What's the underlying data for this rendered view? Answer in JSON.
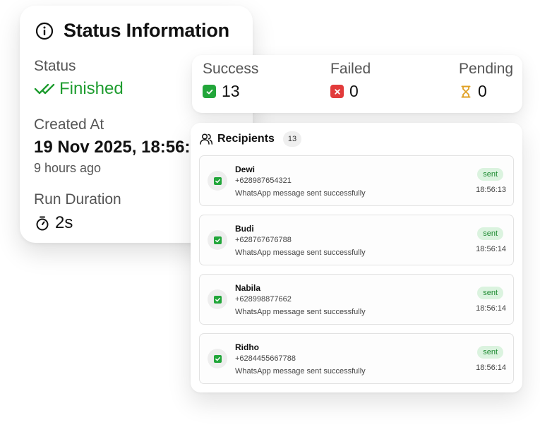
{
  "status_card": {
    "title": "Status Information",
    "status_label": "Status",
    "status_value": "Finished",
    "created_label": "Created At",
    "created_value": "19 Nov 2025, 18:56:13",
    "created_relative": "9 hours ago",
    "duration_label": "Run Duration",
    "duration_value": "2s"
  },
  "stats": {
    "success": {
      "label": "Success",
      "value": "13",
      "icon": "check-square-icon",
      "color": "#22a63a"
    },
    "failed": {
      "label": "Failed",
      "value": "0",
      "icon": "x-square-icon",
      "color": "#e23b3b"
    },
    "pending": {
      "label": "Pending",
      "value": "0",
      "icon": "hourglass-icon",
      "color": "#e0a125"
    }
  },
  "recipients": {
    "title": "Recipients",
    "count": "13",
    "items": [
      {
        "name": "Dewi",
        "phone": "+628987654321",
        "message": "WhatsApp message sent successfully",
        "status": "sent",
        "time": "18:56:13"
      },
      {
        "name": "Budi",
        "phone": "+628767676788",
        "message": "WhatsApp message sent successfully",
        "status": "sent",
        "time": "18:56:14"
      },
      {
        "name": "Nabila",
        "phone": "+628998877662",
        "message": "WhatsApp message sent successfully",
        "status": "sent",
        "time": "18:56:14"
      },
      {
        "name": "Ridho",
        "phone": "+6284455667788",
        "message": "WhatsApp message sent successfully",
        "status": "sent",
        "time": "18:56:14"
      }
    ]
  },
  "colors": {
    "accent_green": "#1e9c2f",
    "sent_badge_bg": "#dbf3df",
    "failed_red": "#e23b3b",
    "pending_amber": "#e0a125"
  }
}
